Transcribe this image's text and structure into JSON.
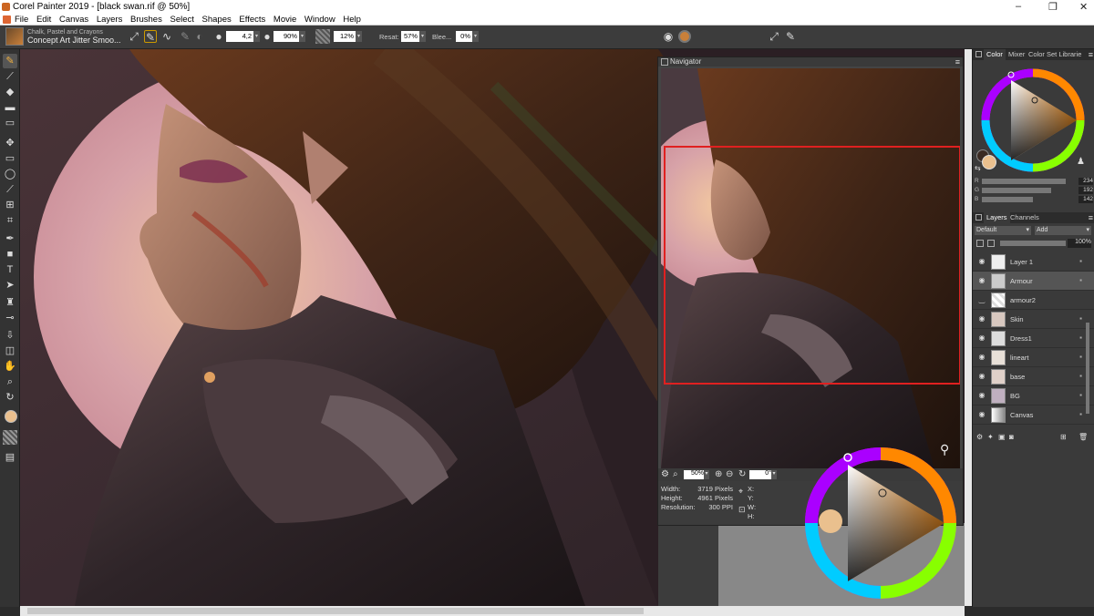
{
  "window": {
    "title": "Corel Painter 2019 - [black swan.rif @ 50%]",
    "minimize": "–",
    "maximize": "❐",
    "close": "✕"
  },
  "menu": [
    "File",
    "Edit",
    "Canvas",
    "Layers",
    "Brushes",
    "Select",
    "Shapes",
    "Effects",
    "Movie",
    "Window",
    "Help"
  ],
  "brush": {
    "category": "Chalk, Pastel and Crayons",
    "variant": "Concept Art Jitter Smoo..."
  },
  "property_bar": {
    "size": "4,2",
    "opacity": "90%",
    "grain": "12%",
    "resat_label": "Resat:",
    "resat": "57%",
    "bleed_label": "Blee...",
    "bleed": "0%"
  },
  "navigator": {
    "title": "Navigator",
    "zoom": "50%",
    "rotation": "0°",
    "width_label": "Width:",
    "width": "3719 Pixels",
    "height_label": "Height:",
    "height": "4961 Pixels",
    "resolution_label": "Resolution:",
    "resolution": "300 PPI",
    "x_label": "X:",
    "y_label": "Y:",
    "w_label": "W:",
    "h_label": "H:"
  },
  "color_panel": {
    "tabs": [
      "Color",
      "Mixer",
      "Color Set Librarie"
    ],
    "r_label": "R",
    "g_label": "G",
    "b_label": "B",
    "r": 234,
    "g": 192,
    "b": 142,
    "main_color": "#eac08e"
  },
  "layers_panel": {
    "tabs": [
      "Layers",
      "Channels"
    ],
    "composite": "Default",
    "depth": "Add",
    "opacity": "100%",
    "layers": [
      {
        "name": "Layer 1",
        "selected": false
      },
      {
        "name": "Armour",
        "selected": true
      },
      {
        "name": "armour2",
        "selected": false
      },
      {
        "name": "Skin",
        "selected": false
      },
      {
        "name": "Dress1",
        "selected": false
      },
      {
        "name": "lineart",
        "selected": false
      },
      {
        "name": "base",
        "selected": false
      },
      {
        "name": "BG",
        "selected": false
      },
      {
        "name": "Canvas",
        "selected": false
      }
    ]
  }
}
